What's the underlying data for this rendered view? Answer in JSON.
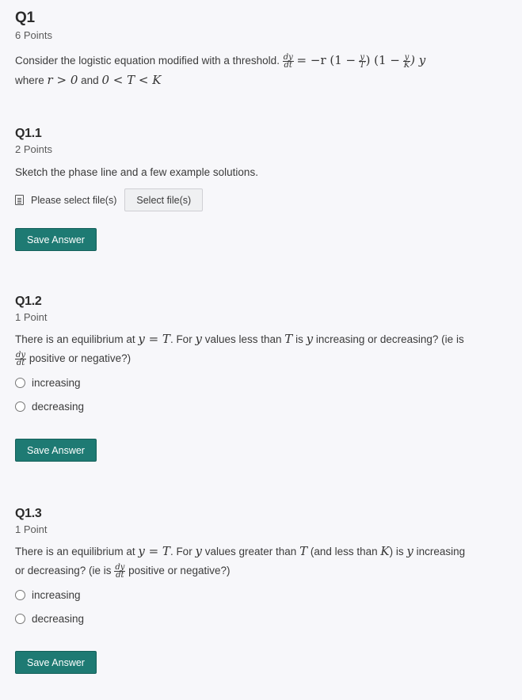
{
  "q1": {
    "title": "Q1",
    "points": "6 Points",
    "prompt_text": "Consider the logistic equation modified with a threshold.",
    "equation": {
      "lhs_num": "dy",
      "lhs_den": "dt",
      "rhs_start": "= −r (1 −",
      "frac1_num": "y",
      "frac1_den": "T",
      "mid": ") (1 −",
      "frac2_num": "y",
      "frac2_den": "K",
      "end": ") y"
    },
    "where_text": "where",
    "cond1": "r > 0",
    "and_text": "and",
    "cond2": "0 < T < K"
  },
  "q1_1": {
    "title": "Q1.1",
    "points": "2 Points",
    "prompt": "Sketch the phase line and a few example solutions.",
    "file_icon": "file-text-icon",
    "file_label": "Please select file(s)",
    "select_button": "Select file(s)",
    "save_button": "Save Answer"
  },
  "q1_2": {
    "title": "Q1.2",
    "points": "1 Point",
    "prompt_a": "There is an equilibrium at",
    "eq": "y = T",
    "prompt_b": ". For",
    "y": "y",
    "prompt_c": "values less than",
    "T": "T",
    "prompt_d": "is",
    "prompt_e": "increasing or decreasing? (ie is",
    "deriv_num": "dy",
    "deriv_den": "dt",
    "prompt_f": "positive or negative?)",
    "options": [
      "increasing",
      "decreasing"
    ],
    "save_button": "Save Answer"
  },
  "q1_3": {
    "title": "Q1.3",
    "points": "1 Point",
    "prompt_a": "There is an equilibrium at",
    "eq": "y = T",
    "prompt_b": ". For",
    "y": "y",
    "prompt_c": "values greater than",
    "T": "T",
    "prompt_d": "(and less than",
    "K": "K",
    "prompt_e": ") is",
    "prompt_f": "increasing",
    "prompt_g": "or decreasing? (ie is",
    "deriv_num": "dy",
    "deriv_den": "dt",
    "prompt_h": "positive or negative?)",
    "options": [
      "increasing",
      "decreasing"
    ],
    "save_button": "Save Answer"
  }
}
